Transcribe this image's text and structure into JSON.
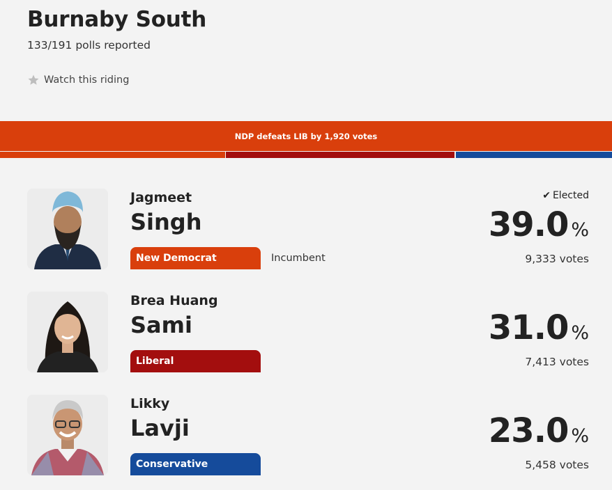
{
  "riding": {
    "name": "Burnaby South",
    "polls_reported": "133/191 polls reported",
    "watch_label": "Watch this riding"
  },
  "banner": {
    "text": "NDP defeats LIB by 1,920 votes",
    "color": "#d93f0c"
  },
  "candidates": [
    {
      "first": "Jagmeet",
      "last": "Singh",
      "party": "New Democrat",
      "party_color": "#d93f0c",
      "incumbent": "Incumbent",
      "elected": "Elected",
      "percent": "39.0",
      "percent_sign": "%",
      "votes": "9,333 votes"
    },
    {
      "first": "Brea Huang",
      "last": "Sami",
      "party": "Liberal",
      "party_color": "#a30e0e",
      "percent": "31.0",
      "percent_sign": "%",
      "votes": "7,413 votes"
    },
    {
      "first": "Likky",
      "last": "Lavji",
      "party": "Conservative",
      "party_color": "#154b9b",
      "percent": "23.0",
      "percent_sign": "%",
      "votes": "5,458 votes"
    }
  ]
}
